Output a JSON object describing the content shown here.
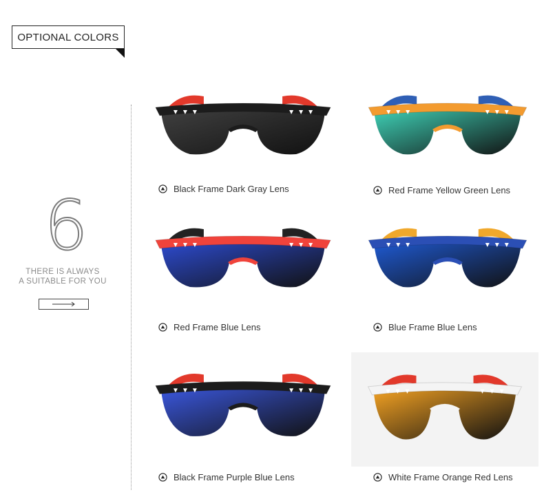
{
  "header": {
    "tag_label": "OPTIONAL COLORS"
  },
  "side": {
    "big_number": "6",
    "tagline_line1": "THERE IS ALWAYS",
    "tagline_line2": "A SUITABLE FOR YOU",
    "arrow_icon": "arrow-right-icon"
  },
  "products": [
    {
      "caption": "Black Frame Dark Gray Lens",
      "frame_color": "#1c1c1c",
      "accent_color": "#e2392b",
      "lens_color": "#404040"
    },
    {
      "caption": "Red Frame Yellow Green Lens",
      "frame_color": "#f39b2f",
      "accent_color": "#2f5fb5",
      "lens_color": "#3fd3b8"
    },
    {
      "caption": "Red Frame Blue Lens",
      "frame_color": "#f0433b",
      "accent_color": "#222222",
      "lens_color": "#2d4bd0"
    },
    {
      "caption": "Blue Frame Blue Lens",
      "frame_color": "#2b4fb5",
      "accent_color": "#f0a82c",
      "lens_color": "#1f5ad3"
    },
    {
      "caption": "Black Frame Purple Blue Lens",
      "frame_color": "#1c1c1c",
      "accent_color": "#e2392b",
      "lens_color": "#3b58e0"
    },
    {
      "caption": "White Frame Orange Red Lens",
      "frame_color": "#f4f4f4",
      "accent_color": "#e2392b",
      "lens_color": "#f5a323"
    }
  ],
  "icons": {
    "caption_icon": "play-circle-icon"
  }
}
